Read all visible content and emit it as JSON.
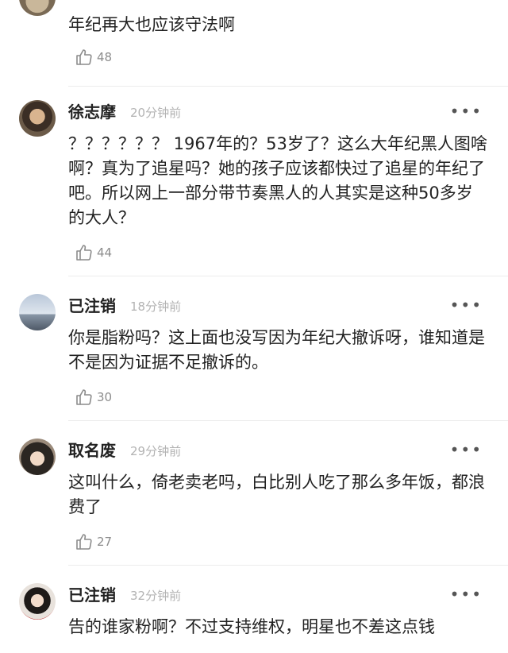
{
  "comments": [
    {
      "username": "",
      "time": "",
      "text": "年纪再大也应该守法啊",
      "likes": "48"
    },
    {
      "username": "徐志摩",
      "time": "20分钟前",
      "text": "？？？？？？ 1967年的？53岁了？这么大年纪黑人图啥啊？真为了追星吗？她的孩子应该都快过了追星的年纪了吧。所以网上一部分带节奏黑人的人其实是这种50多岁的大人？",
      "likes": "44"
    },
    {
      "username": "已注销",
      "time": "18分钟前",
      "text": "你是脂粉吗？这上面也没写因为年纪大撤诉呀，谁知道是不是因为证据不足撤诉的。",
      "likes": "30"
    },
    {
      "username": "取名废",
      "time": "29分钟前",
      "text": "这叫什么，倚老卖老吗，白比别人吃了那么多年饭，都浪费了",
      "likes": "27"
    },
    {
      "username": "已注销",
      "time": "32分钟前",
      "text": "告的谁家粉啊？不过支持维权，明星也不差这点钱",
      "likes": ""
    }
  ],
  "icons": {
    "more": "more-dots-icon",
    "like": "thumbs-up-icon"
  }
}
